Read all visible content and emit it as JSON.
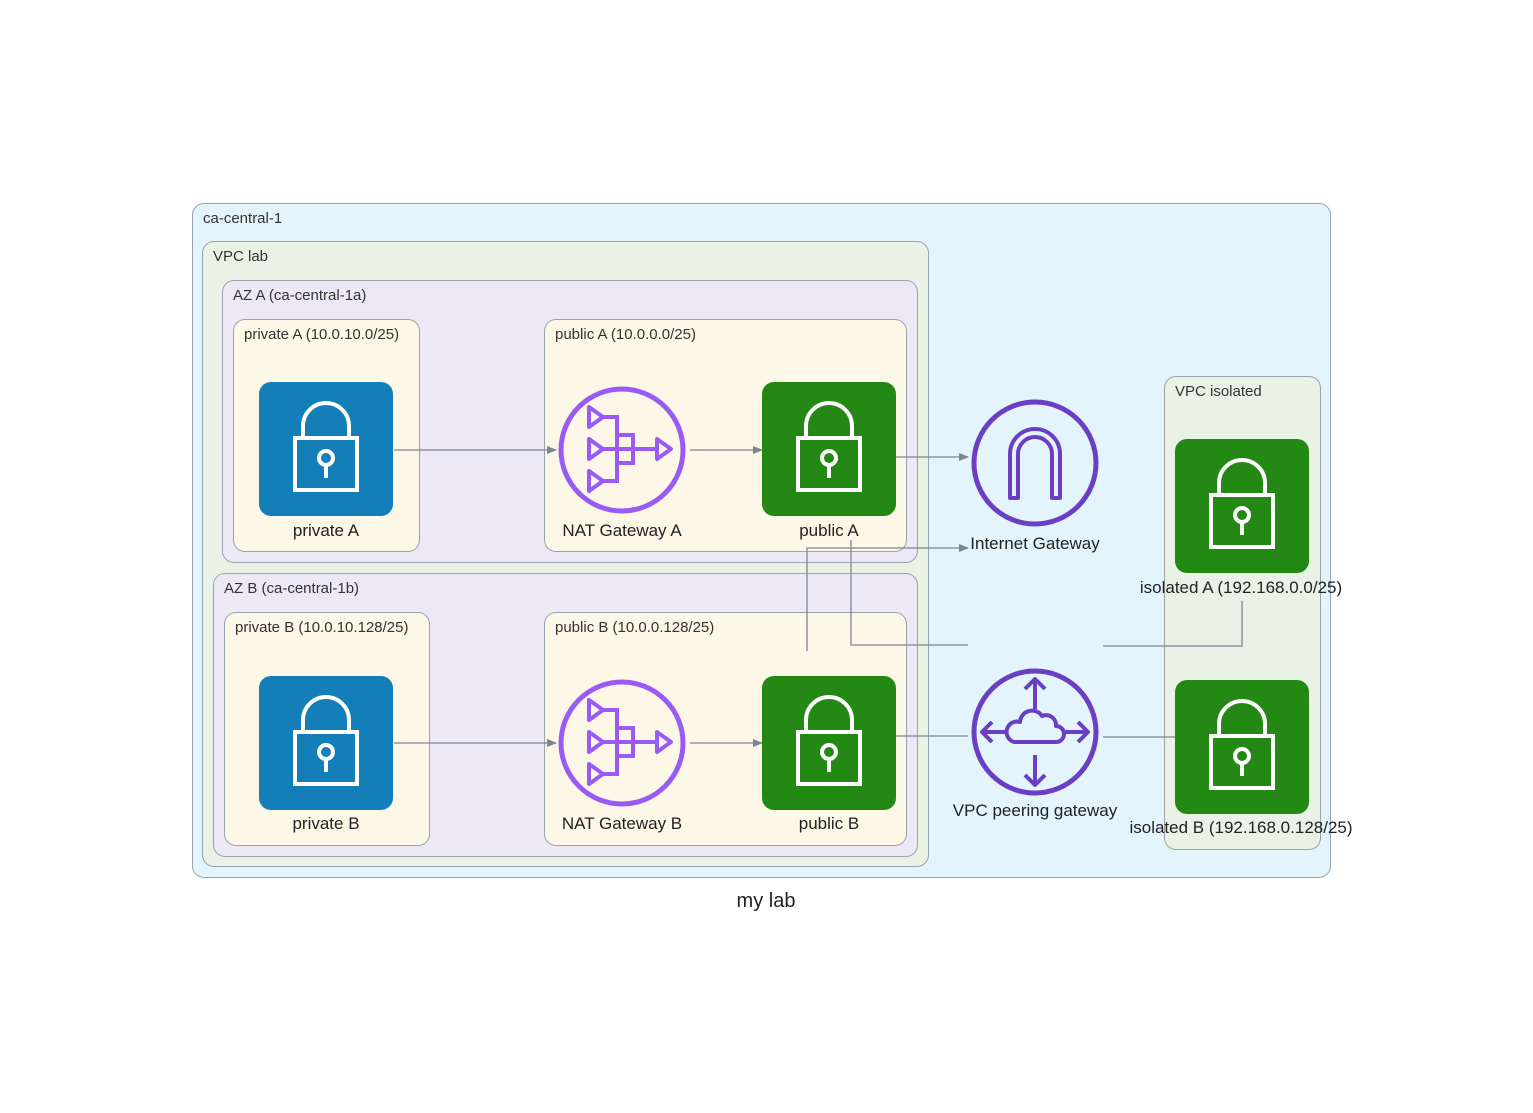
{
  "colors": {
    "region_fill": "#e3f4fc",
    "vpc_fill": "#eaf2e6",
    "az_fill": "#ece8f5",
    "subnet_fill": "#fcf7e6",
    "private_subnet_icon": "#147eb9",
    "public_subnet_icon": "#248814",
    "gateway_purple": "#6a3fc4",
    "nat_purple": "#9a5bf5",
    "edge": "#7b8591"
  },
  "clusters": {
    "region": "ca-central-1",
    "vpc_lab": "VPC lab",
    "az_a": "AZ A (ca-central-1a)",
    "az_b": "AZ B (ca-central-1b)",
    "private_a": "private A (10.0.10.0/25)",
    "public_a": "public A (10.0.0.0/25)",
    "private_b": "private B (10.0.10.128/25)",
    "public_b": "public B (10.0.0.128/25)",
    "vpc_isolated": "VPC isolated"
  },
  "nodes": {
    "private_a": {
      "label": "private A",
      "icon": "lock-icon"
    },
    "nat_a": {
      "label": "NAT Gateway A",
      "icon": "nat-gateway-icon"
    },
    "public_a": {
      "label": "public A",
      "icon": "lock-icon"
    },
    "private_b": {
      "label": "private B",
      "icon": "lock-icon"
    },
    "nat_b": {
      "label": "NAT Gateway B",
      "icon": "nat-gateway-icon"
    },
    "public_b": {
      "label": "public B",
      "icon": "lock-icon"
    },
    "igw": {
      "label": "Internet Gateway",
      "icon": "internet-gateway-icon"
    },
    "peering": {
      "label": "VPC peering gateway",
      "icon": "peering-gateway-icon"
    },
    "isolated_a": {
      "label": "isolated A (192.168.0.0/25)",
      "icon": "lock-icon"
    },
    "isolated_b": {
      "label": "isolated B (192.168.0.128/25)",
      "icon": "lock-icon"
    }
  },
  "edges": [
    {
      "from": "private A",
      "to": "NAT Gateway A",
      "arrow": true
    },
    {
      "from": "NAT Gateway A",
      "to": "public A",
      "arrow": true
    },
    {
      "from": "public A",
      "to": "Internet Gateway",
      "arrow": true
    },
    {
      "from": "private B",
      "to": "NAT Gateway B",
      "arrow": true
    },
    {
      "from": "NAT Gateway B",
      "to": "public B",
      "arrow": true
    },
    {
      "from": "public B",
      "to": "Internet Gateway",
      "arrow": true
    },
    {
      "from": "public A",
      "to": "isolated A (192.168.0.0/25)",
      "arrow": false
    },
    {
      "from": "public B",
      "to": "VPC peering gateway",
      "arrow": false
    },
    {
      "from": "VPC peering gateway",
      "to": "isolated B (192.168.0.128/25)",
      "arrow": false
    }
  ],
  "caption": "my lab"
}
